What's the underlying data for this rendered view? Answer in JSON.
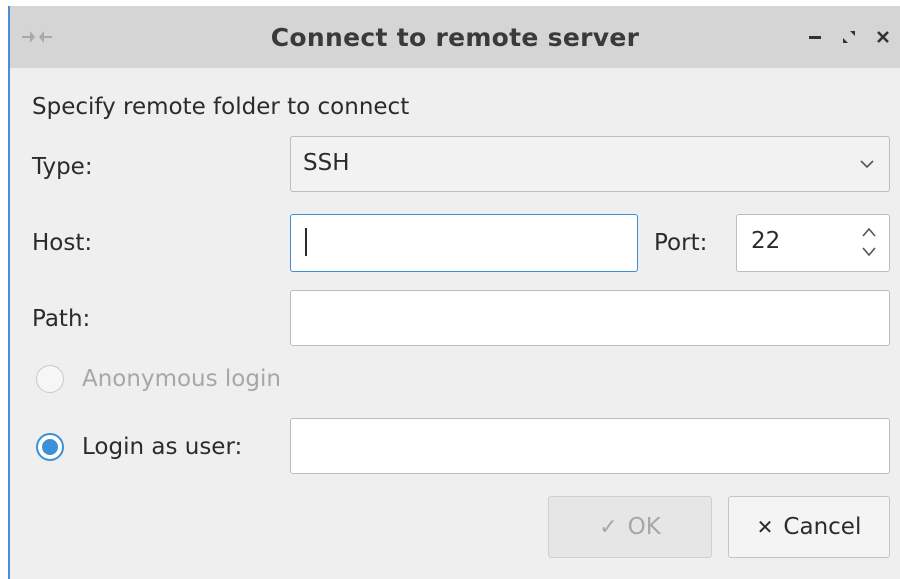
{
  "window": {
    "title": "Connect to remote server",
    "icons": {
      "app": "remote-connect-icon",
      "minimize": "minimize-icon",
      "maximize": "maximize-icon",
      "close": "close-icon"
    }
  },
  "form": {
    "heading": "Specify remote folder to connect",
    "type_label": "Type:",
    "type_value": "SSH",
    "host_label": "Host:",
    "host_value": "",
    "port_label": "Port:",
    "port_value": "22",
    "path_label": "Path:",
    "path_value": "",
    "anonymous_label": "Anonymous login",
    "anonymous_selected": false,
    "login_user_label": "Login as user:",
    "login_user_selected": true,
    "login_user_value": ""
  },
  "buttons": {
    "ok_label": "OK",
    "ok_icon": "checkmark-icon",
    "cancel_label": "Cancel",
    "cancel_icon": "x-icon"
  },
  "colors": {
    "accent": "#3d8fd8",
    "titlebar": "#d5d5d5",
    "background": "#efefef"
  }
}
